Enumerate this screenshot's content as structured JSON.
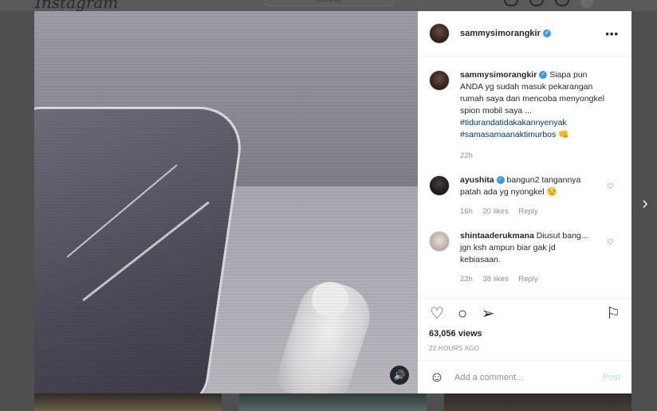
{
  "topbar": {
    "logo": "Instagram",
    "search_placeholder": "Search"
  },
  "post": {
    "username": "sammysimorangkir",
    "caption_text": "Siapa pun ANDA yg sudah masuk pekarangan rumah saya dan mencoba menyongkel spion mobil saya ...",
    "hashtag1": "#tidurandatidakakannyenyak",
    "hashtag2": "#samasamaanaktimurbos",
    "hashtag_emoji": "👊",
    "caption_time": "22h",
    "views": "63,056 views",
    "time_ago": "22 HOURS AGO"
  },
  "comments": [
    {
      "username": "ayushita",
      "text": "bangun2 tangannya patah ada yg nyongkel 😒",
      "time": "16h",
      "likes": "20 likes",
      "reply": "Reply"
    },
    {
      "username": "shintaaderukmana",
      "text": "Diusut bang... jgn ksh ampun biar gak jd kebiasaan.",
      "time": "22h",
      "likes": "38 likes",
      "reply": "Reply"
    }
  ],
  "add_comment": {
    "placeholder": "Add a comment...",
    "post_label": "Post"
  },
  "icons": {
    "more": "more-options-icon",
    "heart": "heart-icon",
    "comment": "comment-icon",
    "share": "share-icon",
    "save": "bookmark-icon",
    "emoji": "emoji-icon",
    "sound": "speaker-icon",
    "next": "chevron-right-icon"
  },
  "colors": {
    "verified": "#3897f0",
    "hashtag": "#00376b",
    "post_button": "#b2dffc"
  }
}
